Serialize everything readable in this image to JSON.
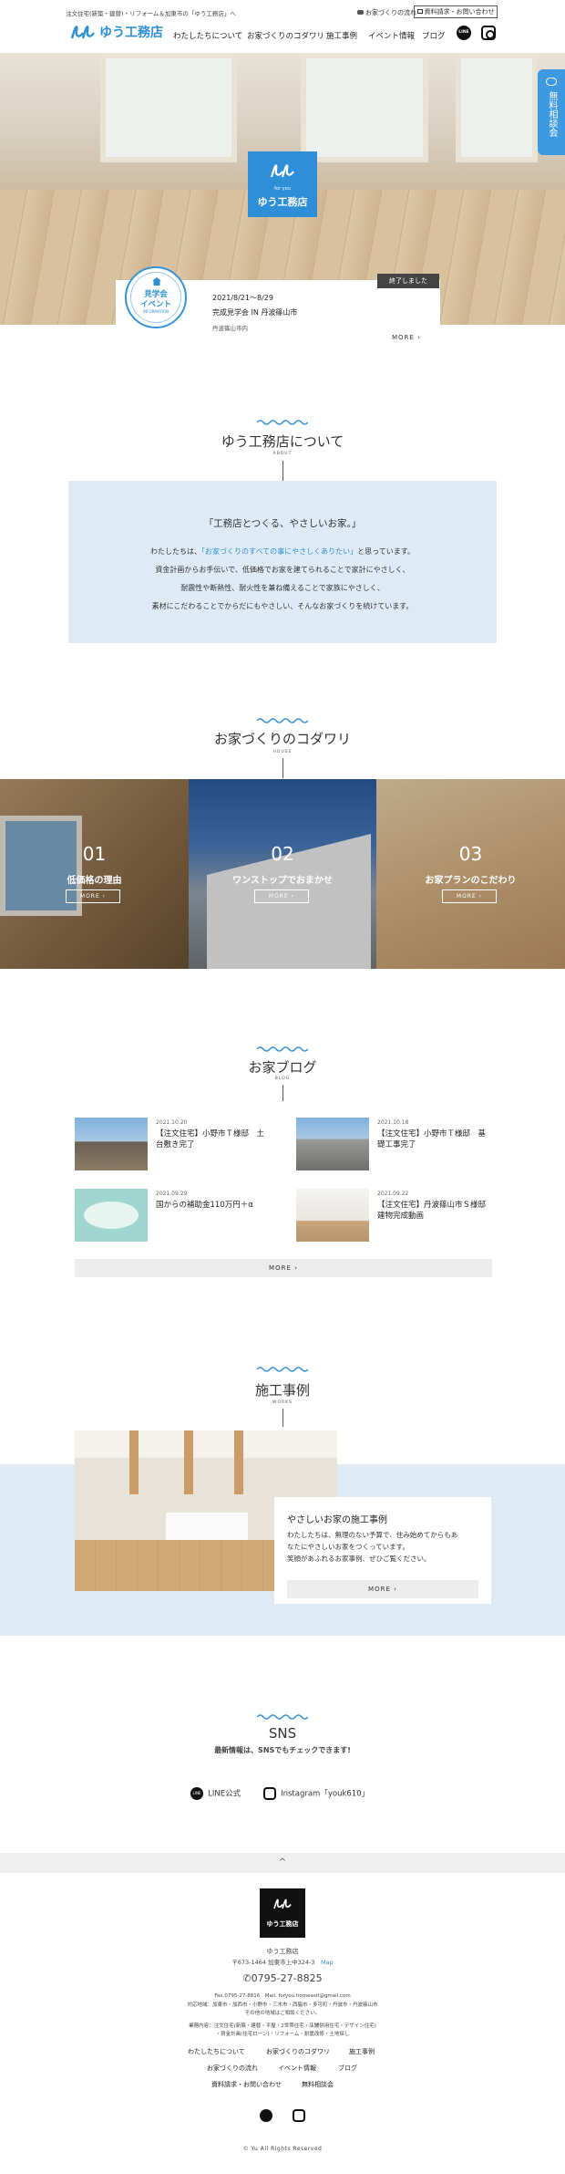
{
  "header": {
    "tagline": "注文住宅(新築・建替)・リフォーム＆加東市の「ゆう工務店」へ",
    "logo_text": "ゆう工務店",
    "flow_link": "お家づくりの流れ",
    "request_button": "資料請求・お問い合わせ",
    "nav": [
      "わたしたちについて",
      "お家づくりのコダワリ",
      "施工事例",
      "イベント情報",
      "ブログ"
    ],
    "line_icon_label": "LINE"
  },
  "hero": {
    "logo_sub": "for you",
    "logo_text": "ゆう工務店",
    "side_button": "無料相談会"
  },
  "event": {
    "badge_line1": "見学会",
    "badge_line2": "イベント",
    "badge_en": "INFORMATION",
    "status": "終了しました",
    "date": "2021/8/21～8/29",
    "title": "完成見学会 IN 丹波篠山市",
    "location": "丹波篠山市内",
    "more": "MORE"
  },
  "about": {
    "title": "ゆう工務店について",
    "subtitle": "ABOUT",
    "headline": "「工務店とつくる、やさしいお家。」",
    "body_pre": "わたしたちは、",
    "body_highlight": "「お家づくりのすべての事にやさしくありたい」",
    "body_post": "と思っています。",
    "body_lines": [
      "資金計画からお手伝いで、低価格でお家を建てられることで家計にやさしく、",
      "耐震性や断熱性、耐火性を兼ね備えることで家族にやさしく、",
      "素材にこだわることでからだにもやさしい、そんなお家づくりを続けています。"
    ]
  },
  "house": {
    "title": "お家づくりのコダワリ",
    "subtitle": "HOUSE",
    "panels": [
      {
        "num": "01",
        "title": "低価格の理由",
        "more": "MORE"
      },
      {
        "num": "02",
        "title": "ワンストップでおまかせ",
        "more": "MORE"
      },
      {
        "num": "03",
        "title": "お家プランのこだわり",
        "more": "MORE"
      }
    ]
  },
  "blog": {
    "title": "お家ブログ",
    "subtitle": "BLOG",
    "posts": [
      {
        "date": "2021.10.20",
        "title": "【注文住宅】小野市Ｔ様邸　土台敷き完了"
      },
      {
        "date": "2021.10.18",
        "title": "【注文住宅】小野市Ｔ様邸　基礎工事完了"
      },
      {
        "date": "2021.09.29",
        "title": "国からの補助金110万円＋α"
      },
      {
        "date": "2021.09.22",
        "title": "【注文住宅】丹波篠山市Ｓ様邸　建物完成動画"
      }
    ],
    "more": "MORE"
  },
  "works": {
    "title": "施工事例",
    "subtitle": "WORKS",
    "card_title": "やさしいお家の施工事例",
    "card_lines": [
      "わたしたちは、無理のない予算で、住み始めてからもあ",
      "なたにやさしいお家をつくっています。",
      "笑顔があふれるお家事例、ぜひご覧ください。"
    ],
    "more": "MORE"
  },
  "sns": {
    "title": "SNS",
    "lead": "最新情報は、SNSでもチェックできます!",
    "line_label": "LINE公式",
    "instagram_label": "Instagram「youk610」"
  },
  "footer": {
    "pagetop": "^",
    "company": "ゆう工務店",
    "address": "〒673-1464 加東市上中324-3",
    "map": "Map",
    "tel": "0795-27-8825",
    "fax_mail": "Fax.0795-27-8816　Mail. foryou.homeastl@gmail.com",
    "area1": "対応地域：加東市・加西市・小野市・三木市・西脇市・多可町・丹波市・丹波篠山市",
    "area2": "その他の地域はご相談ください。",
    "biz1": "業務内容：注文住宅(新築・建替・平屋・2世帯住宅・店舗併用住宅・デザイン住宅)",
    "biz2": "・資金計画(住宅ローン)・リフォーム・耐震改修・土地探し",
    "nav": [
      "わたしたちについて",
      "お家づくりのコダワリ",
      "施工事例",
      "お家づくりの流れ",
      "イベント情報",
      "ブログ",
      "資料請求・お問い合わせ",
      "無料相談会"
    ],
    "copyright": "© Yu All Rights Reserved"
  },
  "colors": {
    "accent": "#2f8fd0",
    "light_blue_bg": "#deebf5"
  }
}
